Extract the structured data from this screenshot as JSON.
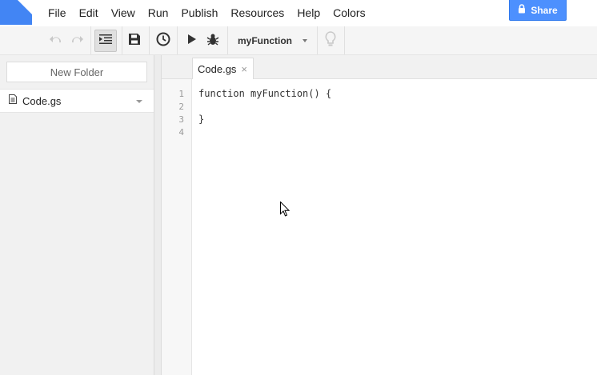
{
  "menu": {
    "items": [
      "File",
      "Edit",
      "View",
      "Run",
      "Publish",
      "Resources",
      "Help",
      "Colors"
    ],
    "share_label": "Share"
  },
  "toolbar": {
    "selected_function": "myFunction",
    "icons": [
      "undo-icon",
      "redo-icon",
      "indent-icon",
      "save-icon",
      "clock-icon",
      "run-icon",
      "debug-icon",
      "lightbulb-icon"
    ]
  },
  "sidebar": {
    "new_folder_label": "New Folder",
    "files": [
      {
        "name": "Code.gs"
      }
    ]
  },
  "editor": {
    "tab_label": "Code.gs",
    "tab_close": "×",
    "line_numbers": [
      "1",
      "2",
      "3",
      "4"
    ],
    "lines": [
      "function myFunction() {",
      "",
      "}",
      ""
    ]
  },
  "colors": {
    "brand": "#4285f4",
    "share": "#4d90fe"
  }
}
